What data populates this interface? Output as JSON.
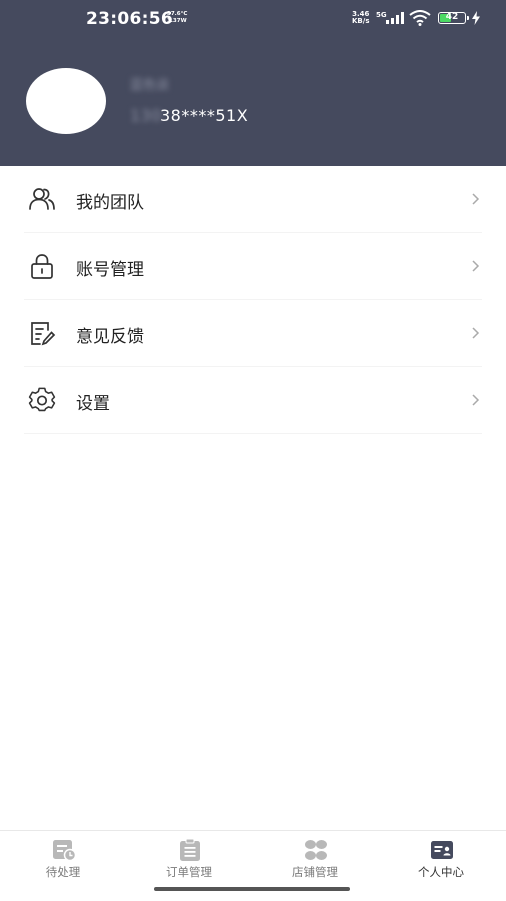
{
  "status_bar": {
    "time": "23:06:56",
    "temp": "37.6°C",
    "power": "3.37W",
    "speed_value": "3.46",
    "speed_unit": "KB/s",
    "network": "5G",
    "battery": "42"
  },
  "profile": {
    "name": "蓝色谈",
    "phone_prefix": "130",
    "phone_visible": "38****51X"
  },
  "menu": [
    {
      "label": "我的团队",
      "icon": "team-icon"
    },
    {
      "label": "账号管理",
      "icon": "lock-icon"
    },
    {
      "label": "意见反馈",
      "icon": "feedback-icon"
    },
    {
      "label": "设置",
      "icon": "gear-icon"
    }
  ],
  "tabs": [
    {
      "label": "待处理",
      "icon": "pending-icon",
      "active": false
    },
    {
      "label": "订单管理",
      "icon": "clipboard-icon",
      "active": false
    },
    {
      "label": "店铺管理",
      "icon": "store-grid-icon",
      "active": false
    },
    {
      "label": "个人中心",
      "icon": "profile-card-icon",
      "active": true
    }
  ],
  "colors": {
    "header_bg": "#454a5e",
    "tab_icon": "#b8b8b8",
    "tab_icon_active": "#454a5e",
    "battery_fill": "#4cd964"
  }
}
